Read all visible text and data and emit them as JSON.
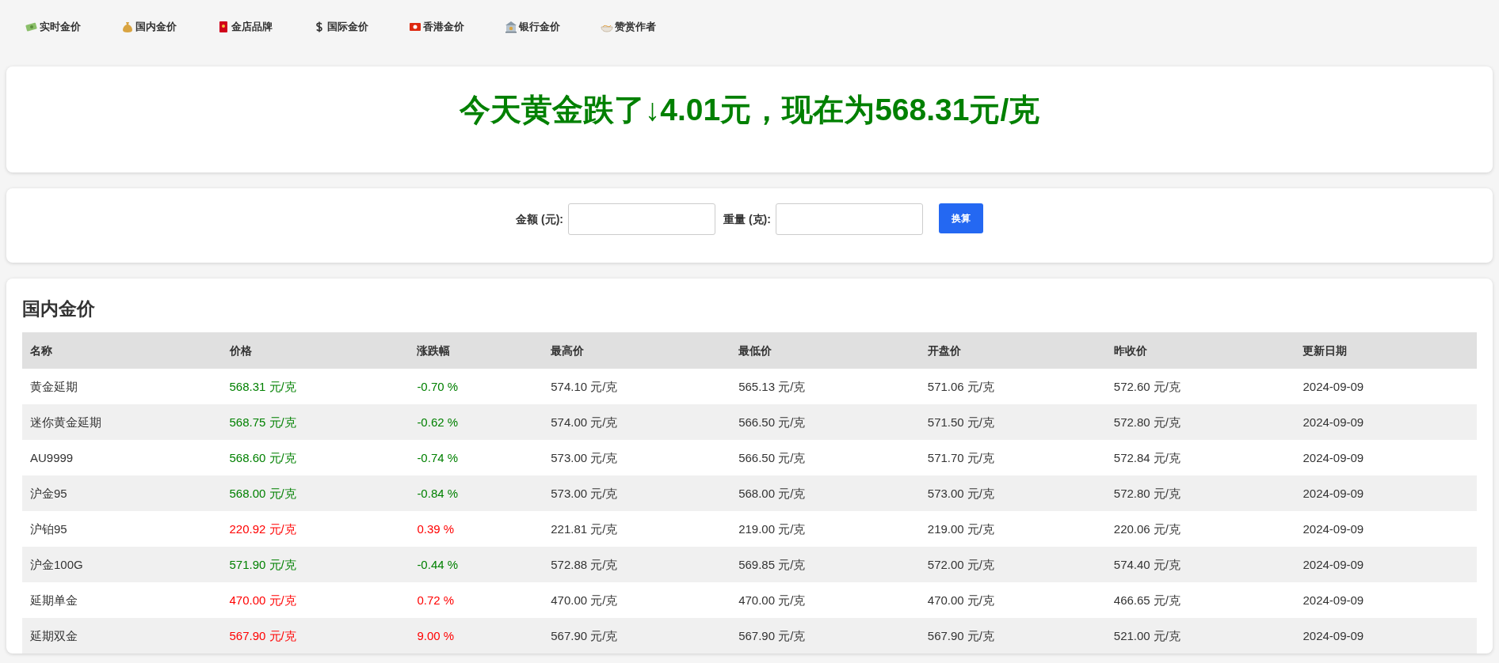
{
  "nav": [
    {
      "label": "实时金价"
    },
    {
      "label": "国内金价"
    },
    {
      "label": "金店品牌"
    },
    {
      "label": "国际金价"
    },
    {
      "label": "香港金价"
    },
    {
      "label": "银行金价"
    },
    {
      "label": "赞赏作者"
    }
  ],
  "headline": {
    "text": "今天黄金跌了↓4.01元，现在为568.31元/克",
    "color": "#008000"
  },
  "converter": {
    "amount_label": "金额 (元):",
    "weight_label": "重量 (克):",
    "button": "换算"
  },
  "table": {
    "title": "国内金价",
    "columns": [
      "名称",
      "价格",
      "涨跌幅",
      "最高价",
      "最低价",
      "开盘价",
      "昨收价",
      "更新日期"
    ],
    "rows": [
      {
        "color": "#008000",
        "cells": [
          "黄金延期",
          "568.31 元/克",
          "-0.70 %",
          "574.10 元/克",
          "565.13 元/克",
          "571.06 元/克",
          "572.60 元/克",
          "2024-09-09"
        ]
      },
      {
        "color": "#008000",
        "cells": [
          "迷你黄金延期",
          "568.75 元/克",
          "-0.62 %",
          "574.00 元/克",
          "566.50 元/克",
          "571.50 元/克",
          "572.80 元/克",
          "2024-09-09"
        ]
      },
      {
        "color": "#008000",
        "cells": [
          "AU9999",
          "568.60 元/克",
          "-0.74 %",
          "573.00 元/克",
          "566.50 元/克",
          "571.70 元/克",
          "572.84 元/克",
          "2024-09-09"
        ]
      },
      {
        "color": "#008000",
        "cells": [
          "沪金95",
          "568.00 元/克",
          "-0.84 %",
          "573.00 元/克",
          "568.00 元/克",
          "573.00 元/克",
          "572.80 元/克",
          "2024-09-09"
        ]
      },
      {
        "color": "#ff0000",
        "cells": [
          "沪铂95",
          "220.92 元/克",
          "0.39 %",
          "221.81 元/克",
          "219.00 元/克",
          "219.00 元/克",
          "220.06 元/克",
          "2024-09-09"
        ]
      },
      {
        "color": "#008000",
        "cells": [
          "沪金100G",
          "571.90 元/克",
          "-0.44 %",
          "572.88 元/克",
          "569.85 元/克",
          "572.00 元/克",
          "574.40 元/克",
          "2024-09-09"
        ]
      },
      {
        "color": "#ff0000",
        "cells": [
          "延期单金",
          "470.00 元/克",
          "0.72 %",
          "470.00 元/克",
          "470.00 元/克",
          "470.00 元/克",
          "466.65 元/克",
          "2024-09-09"
        ]
      },
      {
        "color": "#ff0000",
        "cells": [
          "延期双金",
          "567.90 元/克",
          "9.00 %",
          "567.90 元/克",
          "567.90 元/克",
          "567.90 元/克",
          "521.00 元/克",
          "2024-09-09"
        ]
      }
    ]
  }
}
